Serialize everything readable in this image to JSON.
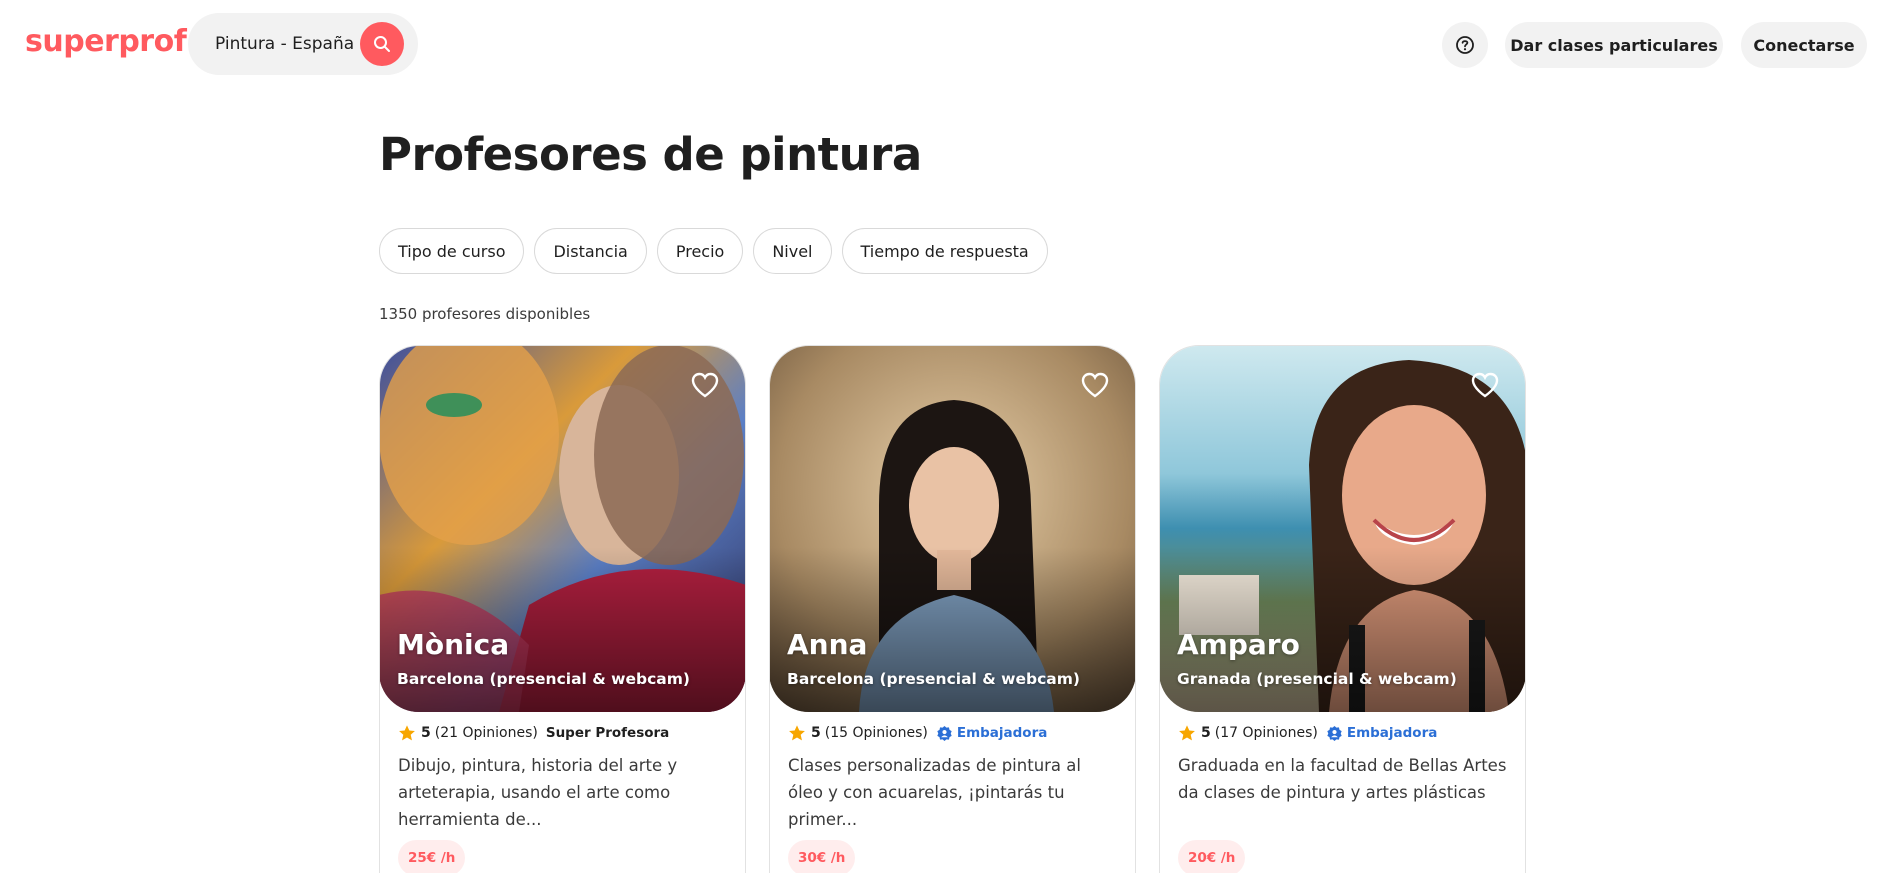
{
  "header": {
    "logo": "superprof",
    "search_value": "Pintura - España",
    "search_icon": "search-icon",
    "help_icon": "help-circle-icon",
    "give_classes_label": "Dar clases particulares",
    "login_label": "Conectarse"
  },
  "main": {
    "title": "Profesores de pintura",
    "filters": [
      "Tipo de curso",
      "Distancia",
      "Precio",
      "Nivel",
      "Tiempo de respuesta"
    ],
    "count_label": "1350 profesores disponibles"
  },
  "cards": [
    {
      "name": "Mònica",
      "location": "Barcelona (presencial & webcam)",
      "rating": "5",
      "reviews": "(21 Opiniones)",
      "badge": "Super Profesora",
      "badge_type": "super",
      "description": "Dibujo, pintura, historia del arte y arteterapia, usando el arte como herramienta de...",
      "price": "25€ /h"
    },
    {
      "name": "Anna",
      "location": "Barcelona (presencial & webcam)",
      "rating": "5",
      "reviews": "(15 Opiniones)",
      "badge": "Embajadora",
      "badge_type": "ambassador",
      "description": "Clases personalizadas de pintura al óleo y con acuarelas, ¡pintarás tu primer...",
      "price": "30€ /h"
    },
    {
      "name": "Amparo",
      "location": "Granada (presencial & webcam)",
      "rating": "5",
      "reviews": "(17 Opiniones)",
      "badge": "Embajadora",
      "badge_type": "ambassador",
      "description": "Graduada en la facultad de Bellas Artes da clases de pintura y artes plásticas",
      "price": "20€ /h"
    }
  ],
  "colors": {
    "brand": "#ff5a5f",
    "ambassador": "#2b6fd6",
    "star": "#f7a600",
    "chip_bg": "#f2f2f2"
  }
}
